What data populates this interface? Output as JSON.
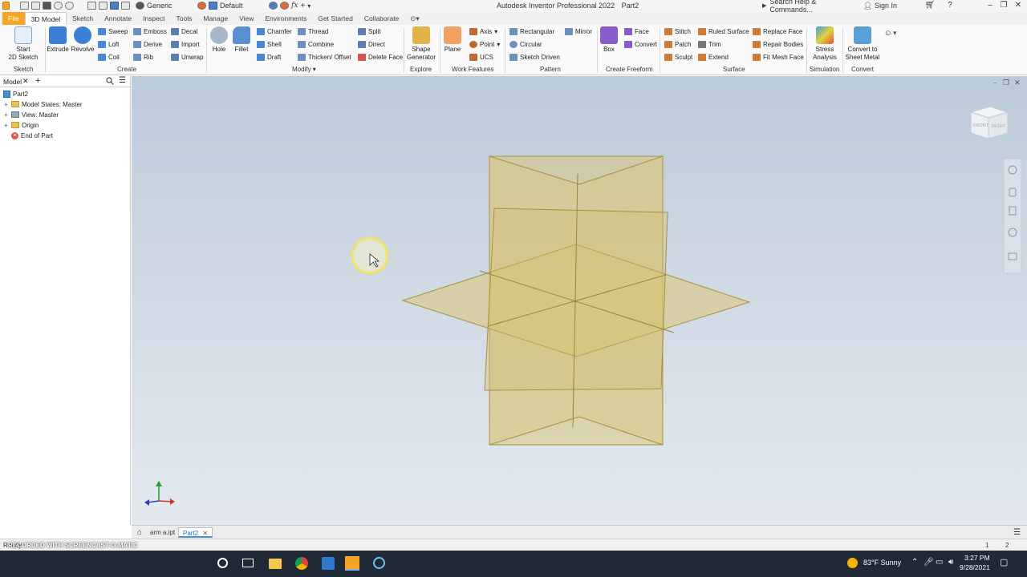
{
  "window": {
    "title": "Autodesk Inventor Professional 2022",
    "document": "Part2",
    "quick_access": {
      "appearance": "Generic",
      "material": "Default"
    },
    "search_placeholder": "Search Help & Commands...",
    "sign_in": "Sign In"
  },
  "tabs": [
    "File",
    "3D Model",
    "Sketch",
    "Annotate",
    "Inspect",
    "Tools",
    "Manage",
    "View",
    "Environments",
    "Get Started",
    "Collaborate"
  ],
  "ribbon": {
    "start_sketch": "Start\n2D Sketch",
    "extrude": "Extrude",
    "revolve": "Revolve",
    "sweep": "Sweep",
    "loft": "Loft",
    "coil": "Coil",
    "emboss": "Emboss",
    "derive": "Derive",
    "rib": "Rib",
    "decal": "Decal",
    "import": "Import",
    "unwrap": "Unwrap",
    "hole": "Hole",
    "fillet": "Fillet",
    "chamfer": "Chamfer",
    "shell": "Shell",
    "draft": "Draft",
    "thread": "Thread",
    "combine": "Combine",
    "thicken": "Thicken/ Offset",
    "split": "Split",
    "direct": "Direct",
    "delete_face": "Delete Face",
    "shape_generator": "Shape\nGenerator",
    "plane": "Plane",
    "axis": "Axis",
    "point": "Point",
    "ucs": "UCS",
    "rectangular": "Rectangular",
    "circular": "Circular",
    "sketch_driven": "Sketch Driven",
    "mirror": "Mirror",
    "box": "Box",
    "face": "Face",
    "convert": "Convert",
    "stitch": "Stitch",
    "patch": "Patch",
    "sculpt": "Sculpt",
    "ruled_surface": "Ruled Surface",
    "trim": "Trim",
    "extend": "Extend",
    "replace_face": "Replace Face",
    "repair_bodies": "Repair Bodies",
    "fit_mesh_face": "Fit Mesh Face",
    "stress_analysis": "Stress\nAnalysis",
    "convert_sheet_metal": "Convert to\nSheet Metal",
    "panels": {
      "sketch": "Sketch",
      "create": "Create",
      "modify": "Modify",
      "explore": "Explore",
      "work_features": "Work Features",
      "pattern": "Pattern",
      "create_freeform": "Create Freeform",
      "surface": "Surface",
      "simulation": "Simulation",
      "convert": "Convert"
    }
  },
  "browser": {
    "tab": "Model",
    "items": [
      "Part2",
      "Model States: Master",
      "View: Master",
      "Origin",
      "End of Part"
    ]
  },
  "viewcube": {
    "front": "FRONT",
    "right": "RIGHT"
  },
  "doc_tabs": [
    "arm a.ipt",
    "Part2"
  ],
  "status": {
    "text": "Ready",
    "counts": [
      "1",
      "2"
    ]
  },
  "watermark": "RECORDED WITH SCREENCAST-O-MATIC",
  "taskbar": {
    "weather": "83°F  Sunny",
    "time": "3:27 PM",
    "date": "9/28/2021"
  },
  "colors": {
    "accent_file": "#f7a323",
    "plane_fill": "#d9c77e",
    "plane_edge": "#a8913a"
  }
}
